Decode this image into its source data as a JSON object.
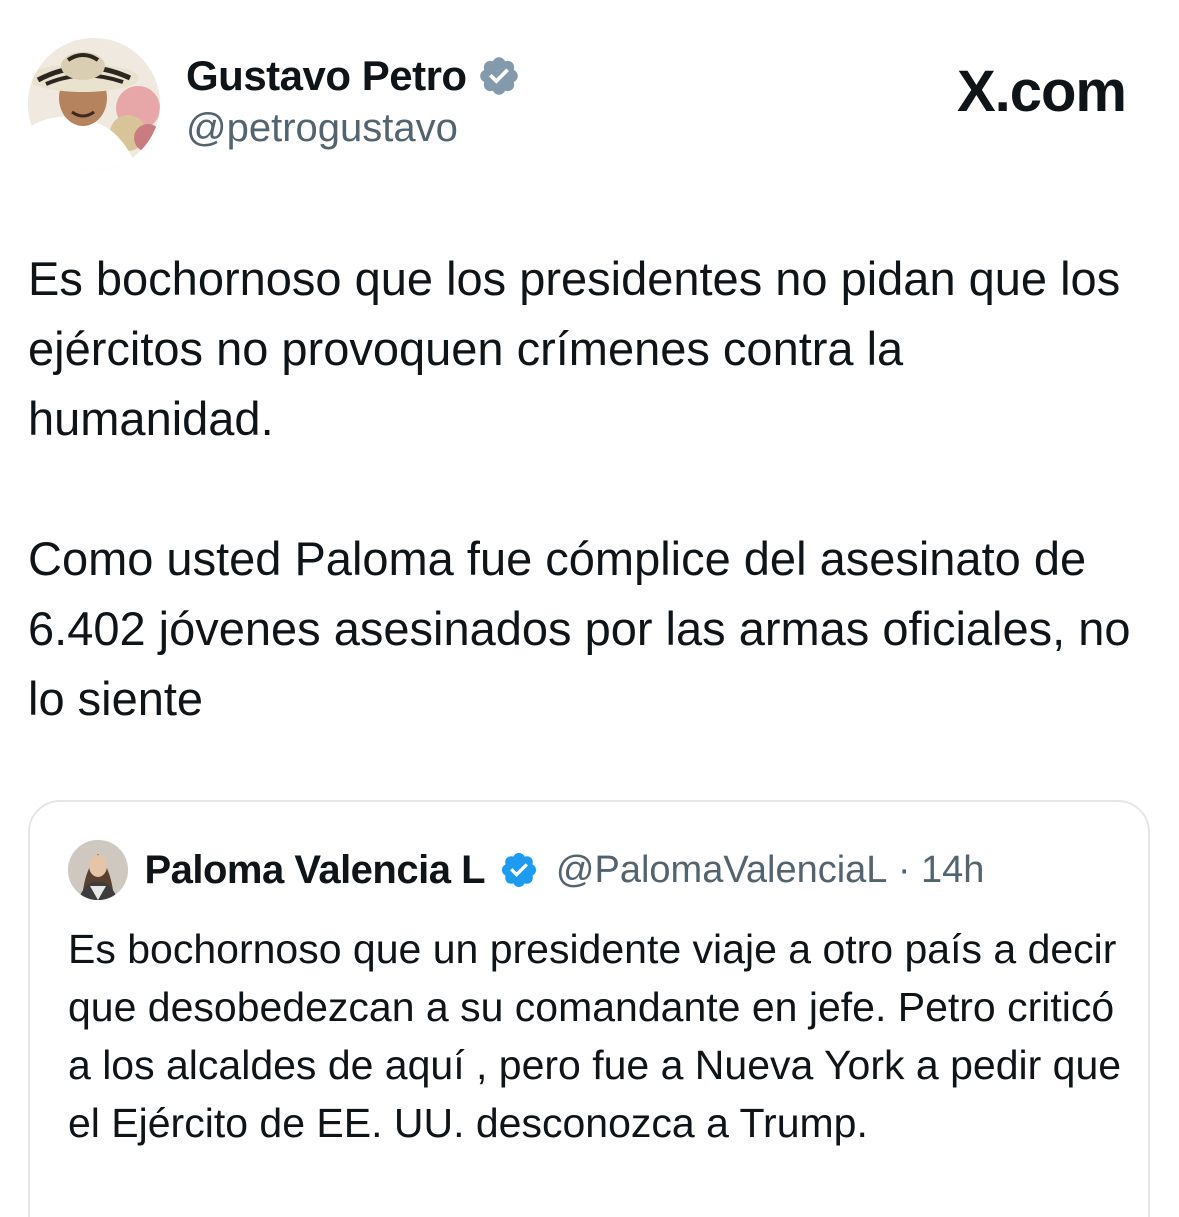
{
  "tweet": {
    "author_name": "Gustavo Petro",
    "author_handle": "@petrogustavo",
    "brand": "X.com",
    "paragraphs": [
      "Es bochornoso que los presidentes no pidan que los ejércitos no provoquen crímenes contra la humanidad.",
      "Como usted Paloma fue cómplice del asesinato de 6.402 jóvenes asesinados por las armas oficiales, no lo siente"
    ],
    "verified_icon": "verified-badge-icon",
    "verified_color": "#829aab"
  },
  "quoted": {
    "author_name": "Paloma Valencia L",
    "author_handle": "@PalomaValenciaL",
    "separator": "·",
    "time": "14h",
    "text": "Es bochornoso que un presidente viaje a otro país a decir que desobedezcan a su comandante en jefe. Petro criticó a los alcaldes de aquí , pero fue a Nueva York a pedir que el Ejército de EE. UU. desconozca a Trump.",
    "verified_icon": "verified-badge-icon",
    "verified_color": "#1d9bf0"
  }
}
